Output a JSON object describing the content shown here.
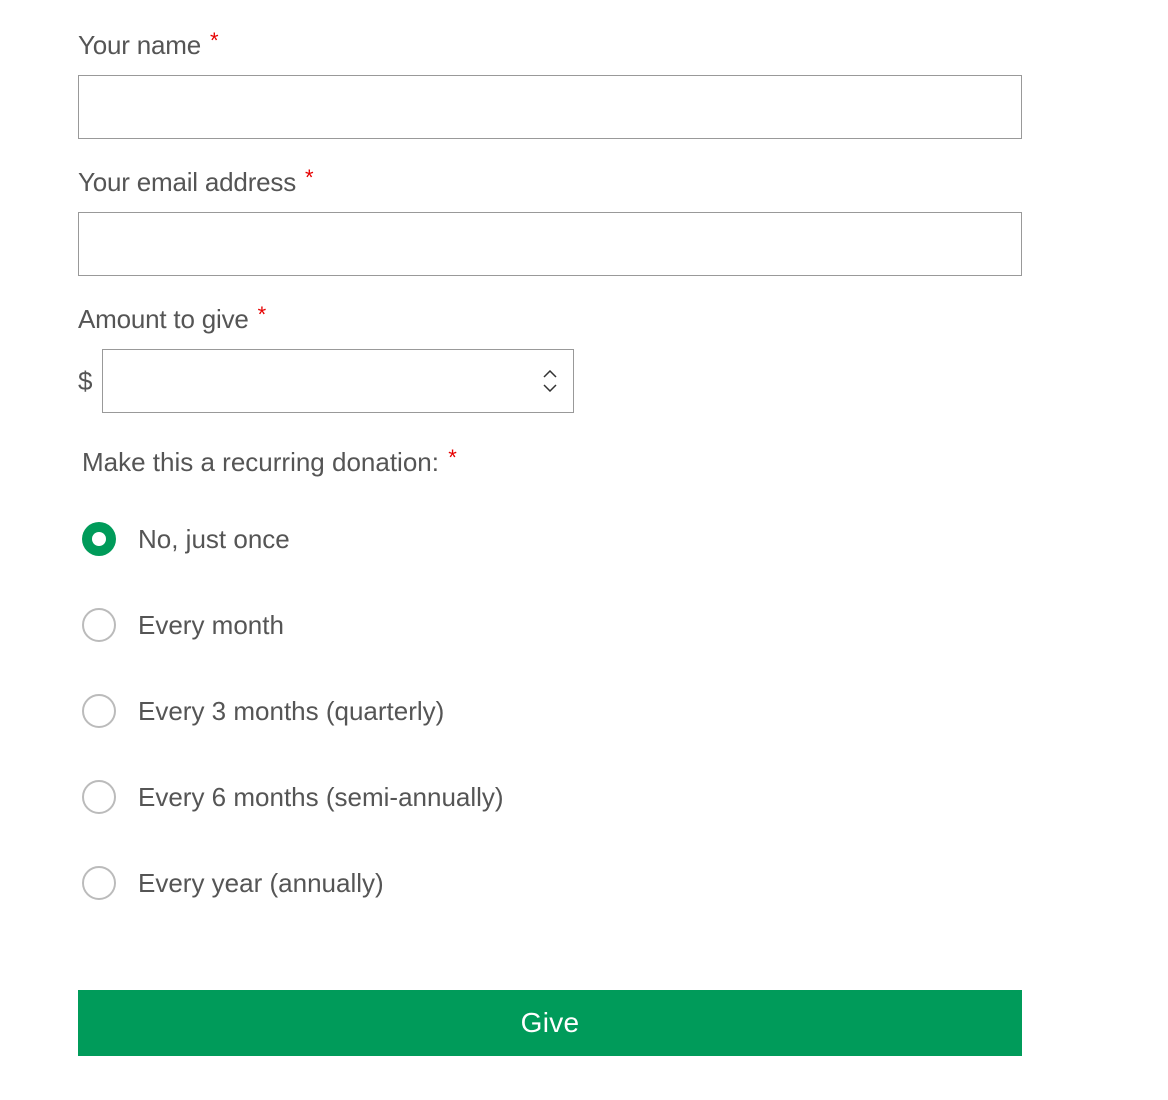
{
  "labels": {
    "name": "Your name",
    "email": "Your email address",
    "amount": "Amount to give",
    "recurring": "Make this a recurring donation:",
    "required_mark": "*"
  },
  "currency_symbol": "$",
  "fields": {
    "name_value": "",
    "email_value": "",
    "amount_value": ""
  },
  "recurring_options": [
    {
      "label": "No, just once",
      "selected": true
    },
    {
      "label": "Every month",
      "selected": false
    },
    {
      "label": "Every 3 months (quarterly)",
      "selected": false
    },
    {
      "label": "Every 6 months (semi-annually)",
      "selected": false
    },
    {
      "label": "Every year (annually)",
      "selected": false
    }
  ],
  "submit_label": "Give",
  "colors": {
    "accent": "#009B5A",
    "required": "#e60000",
    "text": "#555555",
    "border": "#999999",
    "radio_border": "#bbbbbb"
  }
}
